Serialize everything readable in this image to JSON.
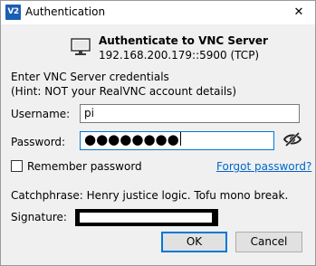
{
  "window": {
    "app_icon": "V2",
    "title": "Authentication",
    "close": "✕"
  },
  "header": {
    "icon": "monitor-icon",
    "title": "Authenticate to VNC Server",
    "address": "192.168.200.179::5900 (TCP)"
  },
  "instructions": {
    "line1": "Enter VNC Server credentials",
    "line2": "(Hint: NOT your RealVNC account details)"
  },
  "username": {
    "label": "Username:",
    "value": "pi"
  },
  "password": {
    "label": "Password:",
    "masked_value": "●●●●●●●●",
    "toggle_icon": "eye-slash-icon"
  },
  "remember": {
    "label": "Remember password",
    "checked": false
  },
  "forgot_link": "Forgot password?",
  "catchphrase": {
    "label": "Catchphrase:",
    "value": "Henry justice logic. Tofu mono break."
  },
  "signature": {
    "label": "Signature:"
  },
  "buttons": {
    "ok": "OK",
    "cancel": "Cancel"
  },
  "colors": {
    "accent": "#0078d7",
    "link": "#0066cc"
  }
}
